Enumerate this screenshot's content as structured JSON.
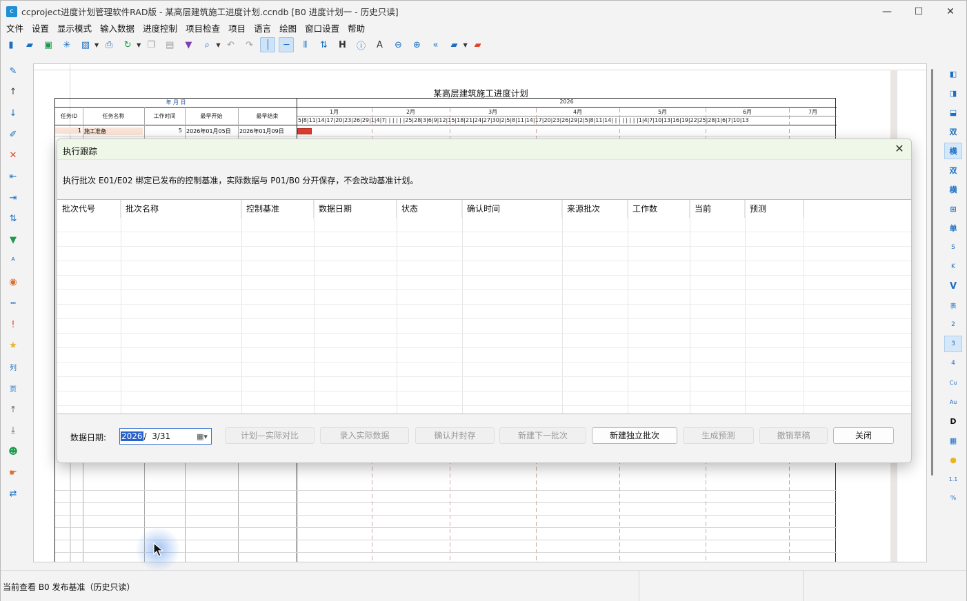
{
  "window": {
    "title": "ccproject进度计划管理软件RAD版 - 某高层建筑施工进度计划.ccndb [B0 进度计划一 - 历史只读]",
    "minimize_glyph": "—",
    "maximize_glyph": "☐",
    "close_glyph": "✕"
  },
  "menu": [
    "文件",
    "设置",
    "显示模式",
    "输入数据",
    "进度控制",
    "项目检查",
    "项目",
    "语言",
    "绘图",
    "窗口设置",
    "帮助"
  ],
  "toolbar_icons": [
    "new-file-icon",
    "open-folder-icon",
    "save-icon",
    "asterisk-icon",
    "export-image-icon",
    "print-icon",
    "refresh-icon",
    "copy-icon",
    "paste-icon",
    "format-brush-icon",
    "search-icon",
    "undo-icon",
    "redo-icon",
    "vertical-line-icon",
    "horizontal-line-icon",
    "columns-icon",
    "sort-icon",
    "heading-icon",
    "info-icon",
    "font-icon",
    "zoom-out-icon",
    "zoom-in-icon",
    "back-icon",
    "folder-icon",
    "red-folder-icon"
  ],
  "left_tools": [
    "pencil-icon",
    "arrow-up-icon",
    "arrow-down-icon",
    "edit-icon",
    "delete-icon",
    "outdent-icon",
    "indent-icon",
    "swap-icon",
    "filter-icon",
    "text-style-icon",
    "palette-icon",
    "dots-icon",
    "exclamation-icon",
    "star-icon",
    "column-icon",
    "page-icon",
    "move-top-icon",
    "move-bottom-icon",
    "group-icon",
    "hand-icon",
    "exchange-icon"
  ],
  "left_tool_labels": {
    "column": "列",
    "page": "页"
  },
  "right_tools": [
    {
      "label": "",
      "icon": "panel-left-icon"
    },
    {
      "label": "",
      "icon": "panel-right-icon"
    },
    {
      "label": "",
      "icon": "panel-bottom-icon"
    },
    {
      "label": "双",
      "icon": "double-icon"
    },
    {
      "label": "横",
      "icon": "horizontal-icon",
      "active": true
    },
    {
      "label": "双",
      "icon": "double-green-icon"
    },
    {
      "label": "横",
      "icon": "horizontal-green-icon"
    },
    {
      "label": "",
      "icon": "table-icon"
    },
    {
      "label": "单",
      "icon": "single-icon"
    },
    {
      "label": "S",
      "icon": "s-icon"
    },
    {
      "label": "K",
      "icon": "k-icon"
    },
    {
      "label": "V",
      "icon": "v-icon"
    },
    {
      "label": "表",
      "icon": "table-char-icon"
    },
    {
      "label": "2",
      "icon": "two-icon"
    },
    {
      "label": "3",
      "icon": "three-icon",
      "active": true
    },
    {
      "label": "4",
      "icon": "four-icon"
    },
    {
      "label": "Cu",
      "icon": "cu-icon"
    },
    {
      "label": "Au",
      "icon": "au-icon"
    },
    {
      "label": "D",
      "icon": "d-icon"
    },
    {
      "label": "",
      "icon": "calculator-icon"
    },
    {
      "label": "",
      "icon": "comment-icon"
    },
    {
      "label": "1.1",
      "icon": "scale-icon"
    },
    {
      "label": "%",
      "icon": "percent-icon"
    }
  ],
  "sheet": {
    "title": "某高层建筑施工进度计划",
    "date_header": "年 月 日",
    "year": "2026",
    "columns": [
      "任务ID",
      "任务名称",
      "工作时间",
      "最早开始",
      "最早结束"
    ],
    "months": [
      "1月",
      "2月",
      "3月",
      "4月",
      "5月",
      "6月",
      "7月"
    ],
    "day_ticks": "5|8|11|14|17|20|23|26|29|1|4|7| | | | | |25|28|3|6|9|12|15|18|21|24|27|30|2|5|8|11|14|17|20|23|26|29|2|5|8|11|14| | | | | | | |1|4|7|10|13|16|19|22|25|28|1|6|7|10|13",
    "rows": [
      {
        "id": "1",
        "name": "施工准备",
        "duration": "5",
        "start": "2026年01月05日",
        "end": "2026年01月09日"
      }
    ]
  },
  "dialog": {
    "title": "执行跟踪",
    "description": "执行批次 E01/E02 绑定已发布的控制基准，实际数据与 P01/B0 分开保存，不会改动基准计划。",
    "columns": [
      "批次代号",
      "批次名称",
      "控制基准",
      "数据日期",
      "状态",
      "确认时间",
      "来源批次",
      "工作数",
      "当前",
      "预测"
    ],
    "date_label": "数据日期:",
    "date_year": "2026",
    "date_rest": "/  3/31",
    "buttons": [
      {
        "label": "计划—实际对比",
        "enabled": false
      },
      {
        "label": "录入实际数据",
        "enabled": false
      },
      {
        "label": "确认并封存",
        "enabled": false
      },
      {
        "label": "新建下一批次",
        "enabled": false
      },
      {
        "label": "新建独立批次",
        "enabled": true
      },
      {
        "label": "生成预测",
        "enabled": false
      },
      {
        "label": "撤销草稿",
        "enabled": false
      },
      {
        "label": "关闭",
        "enabled": true
      }
    ]
  },
  "status": {
    "text": "当前查看 B0 发布基准（历史只读）"
  },
  "colors": {
    "accent": "#1a6fc4",
    "dialog_title_bg": "#eef7e8",
    "gantt_bar": "#e03b2f"
  }
}
